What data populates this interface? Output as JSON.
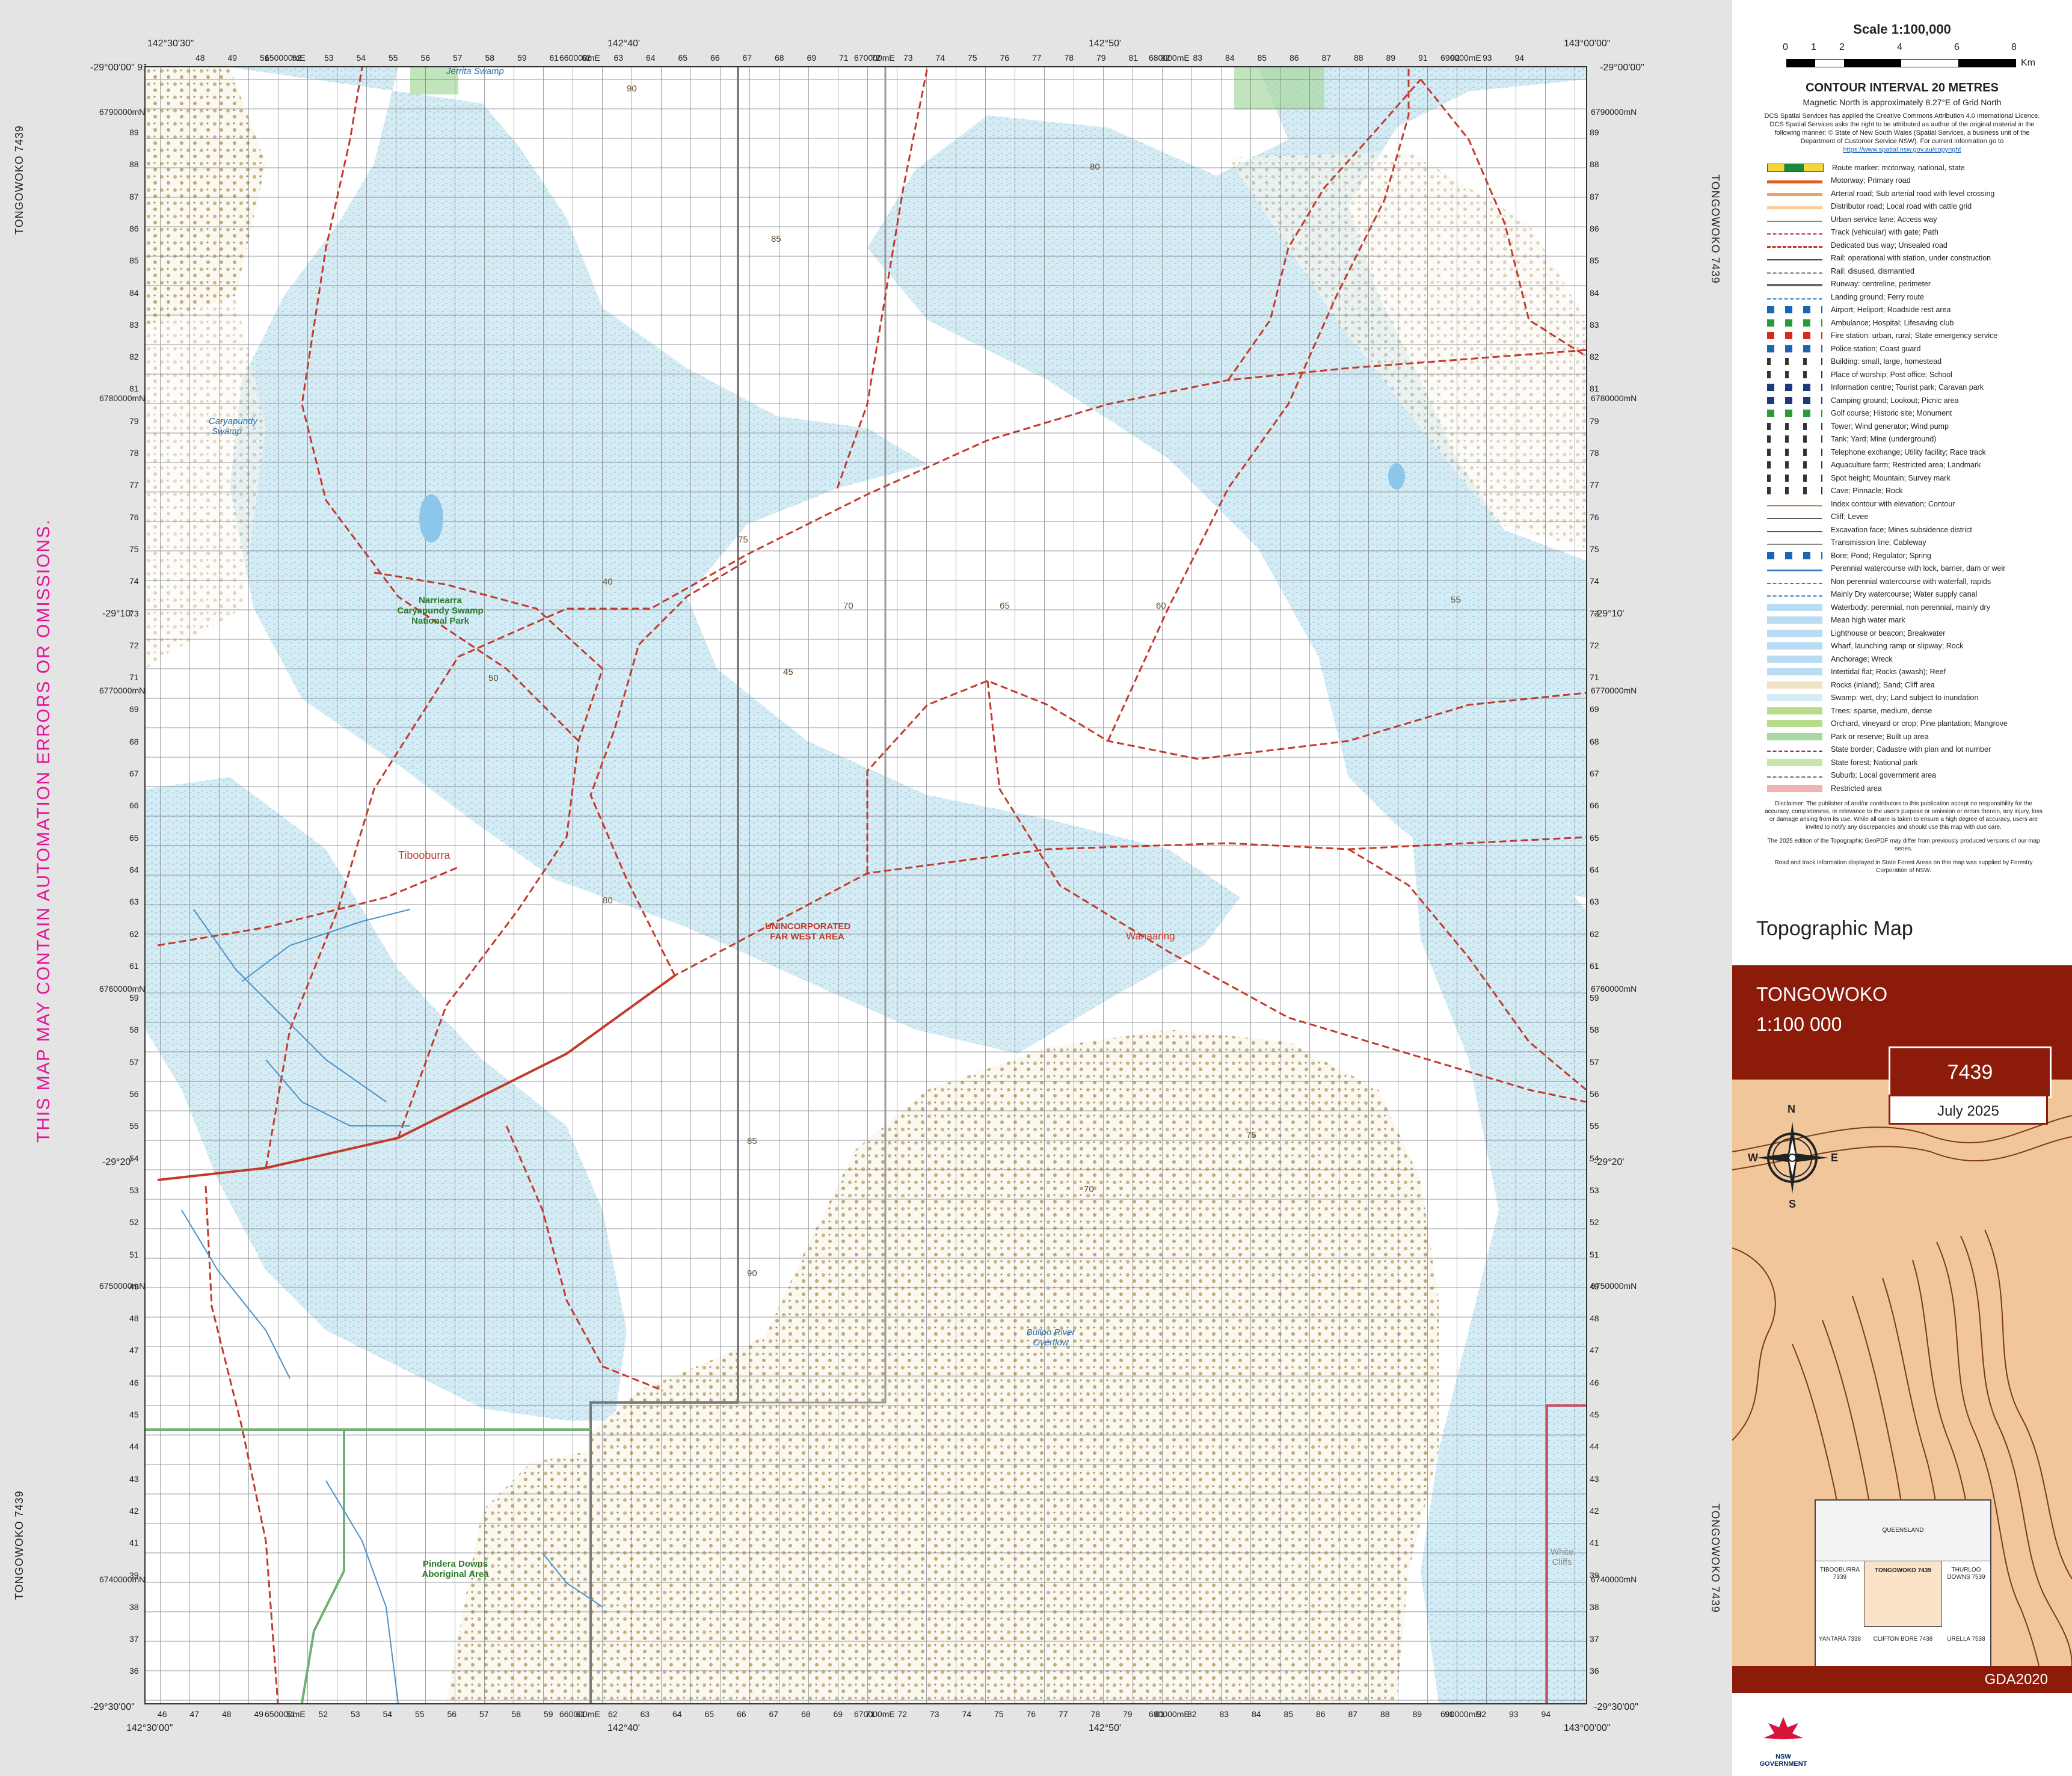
{
  "sheet": {
    "name_upper": "TONGOWOKO",
    "scale_ratio": "1:100 000",
    "sheet_number": "7439",
    "edition_date": "July 2025",
    "datum": "GDA2020",
    "edge_label": "TONGOWOKO 7439",
    "warning": "THIS MAP MAY CONTAIN AUTOMATION ERRORS OR OMISSIONS.",
    "product_title": "Topographic Map"
  },
  "coords": {
    "tl": "-29°00'00\" 91",
    "tr": "-29°00'00\"",
    "bl": "-29°30'00\"",
    "br": "-29°30'00\"",
    "lat_mid1": "-29°10'",
    "lat_mid2": "-29°20'",
    "top_lon_1": "142°30'30\"",
    "top_lon_2": "142°40'",
    "top_lon_3": "142°50'",
    "top_lon_4": "143°00'00\"",
    "bot_lon_1": "142°30'00\"",
    "bot_lon_2": "142°40'",
    "bot_lon_3": "142°50'",
    "bot_lon_4": "143°00'00\"",
    "east_a": "650000mE",
    "east_b": "660000mE",
    "east_c": "670000mE",
    "east_d": "680000mE",
    "east_e": "690000mE",
    "north_a": "6790000mN",
    "north_b": "6780000mN",
    "north_c": "6770000mN",
    "north_d": "6760000mN",
    "north_e": "6750000mN",
    "north_f": "6740000mN"
  },
  "grid": {
    "top_eastings": [
      "48",
      "49",
      "51",
      "52",
      "53",
      "54",
      "55",
      "56",
      "57",
      "58",
      "59",
      "61",
      "62",
      "63",
      "64",
      "65",
      "66",
      "67",
      "68",
      "69",
      "71",
      "72",
      "73",
      "74",
      "75",
      "76",
      "77",
      "78",
      "79",
      "81",
      "82",
      "83",
      "84",
      "85",
      "86",
      "87",
      "88",
      "89",
      "91",
      "92",
      "93",
      "94"
    ],
    "bottom_eastings": [
      "46",
      "47",
      "48",
      "49",
      "51",
      "52",
      "53",
      "54",
      "55",
      "56",
      "57",
      "58",
      "59",
      "61",
      "62",
      "63",
      "64",
      "65",
      "66",
      "67",
      "68",
      "69",
      "71",
      "72",
      "73",
      "74",
      "75",
      "76",
      "77",
      "78",
      "79",
      "81",
      "82",
      "83",
      "84",
      "85",
      "86",
      "87",
      "88",
      "89",
      "91",
      "92",
      "93",
      "94"
    ],
    "northings": [
      "89",
      "88",
      "87",
      "86",
      "85",
      "84",
      "83",
      "82",
      "81",
      "79",
      "78",
      "77",
      "76",
      "75",
      "74",
      "73",
      "72",
      "71",
      "69",
      "68",
      "67",
      "66",
      "65",
      "64",
      "63",
      "62",
      "61",
      "59",
      "58",
      "57",
      "56",
      "55",
      "54",
      "53",
      "52",
      "51",
      "49",
      "48",
      "47",
      "46",
      "45",
      "44",
      "43",
      "42",
      "41",
      "39",
      "38",
      "37",
      "36"
    ]
  },
  "places": {
    "jerrita": "Jerrita Swamp",
    "caryapundy": "Caryapundy Swamp",
    "park": "Narriearra Caryapundy Swamp National Park",
    "tibooburra": "Tibooburra",
    "unincorporated": "UNINCORPORATED FAR WEST AREA",
    "wanaaring": "Wanaaring",
    "pindera": "Pindera Downs Aboriginal Area",
    "bulloo": "Bulloo River Overflow",
    "white_cliffs": "White Cliffs"
  },
  "contour_values": [
    "90",
    "85",
    "80",
    "75",
    "70",
    "65",
    "60",
    "55",
    "50",
    "45",
    "40"
  ],
  "scale": {
    "title": "Scale 1:100,000",
    "ticks": [
      "0",
      "1",
      "2",
      "4",
      "6",
      "8"
    ],
    "unit": "Km",
    "contour_interval": "CONTOUR INTERVAL 20 METRES",
    "magnetic": "Magnetic North is approximately 8.27°E of Grid North"
  },
  "licence": {
    "text": "DCS Spatial Services has applied the Creative Commons Attribution 4.0 International Licence. DCS Spatial Services asks the right to be attributed as author of the original material in the following manner: © State of New South Wales (Spatial Services, a business unit of the Department of Customer Service NSW).",
    "more": "For current information go to",
    "link": "https://www.spatial.nsw.gov.au/copyright"
  },
  "legend": [
    {
      "label": "Route marker: motorway, national, state",
      "sym": "route"
    },
    {
      "label": "Motorway; Primary road",
      "sym": "motorway"
    },
    {
      "label": "Arterial road; Sub arterial road with level crossing",
      "sym": "arterial"
    },
    {
      "label": "Distributor road; Local road with cattle grid",
      "sym": "distributor"
    },
    {
      "label": "Urban service lane; Access way",
      "sym": "thin"
    },
    {
      "label": "Track (vehicular) with gate; Path",
      "sym": "dash"
    },
    {
      "label": "Dedicated bus way; Unsealed road",
      "sym": "unsealed"
    },
    {
      "label": "Rail: operational with station, under construction",
      "sym": "rail"
    },
    {
      "label": "Rail: disused, dismantled",
      "sym": "rail2"
    },
    {
      "label": "Runway: centreline, perimeter",
      "sym": "runway"
    },
    {
      "label": "Landing ground; Ferry route",
      "sym": "ferry"
    },
    {
      "label": "Airport; Heliport; Roadside rest area",
      "sym": "icons-blue"
    },
    {
      "label": "Ambulance; Hospital; Lifesaving club",
      "sym": "icons-green"
    },
    {
      "label": "Fire station: urban, rural; State emergency service",
      "sym": "icons-red"
    },
    {
      "label": "Police station; Coast guard",
      "sym": "icons-blue"
    },
    {
      "label": "Building: small, large, homestead",
      "sym": "icons-dark"
    },
    {
      "label": "Place of worship; Post office; School",
      "sym": "icons-dark"
    },
    {
      "label": "Information centre; Tourist park; Caravan park",
      "sym": "icons-navy"
    },
    {
      "label": "Camping ground; Lookout; Picnic area",
      "sym": "icons-navy"
    },
    {
      "label": "Golf course; Historic site; Monument",
      "sym": "icons-green"
    },
    {
      "label": "Tower; Wind generator; Wind pump",
      "sym": "icons-dark"
    },
    {
      "label": "Tank; Yard; Mine (underground)",
      "sym": "icons-dark"
    },
    {
      "label": "Telephone exchange; Utility facility; Race track",
      "sym": "icons-dark"
    },
    {
      "label": "Aquaculture farm; Restricted area; Landmark",
      "sym": "icons-dark"
    },
    {
      "label": "Spot height; Mountain; Survey mark",
      "sym": "icons-dark"
    },
    {
      "label": "Cave; Pinnacle; Rock",
      "sym": "icons-dark"
    },
    {
      "label": "Index contour with elevation; Contour",
      "sym": "contour"
    },
    {
      "label": "Cliff; Levee",
      "sym": "cliff"
    },
    {
      "label": "Excavation face; Mines subsidence district",
      "sym": "cliff"
    },
    {
      "label": "Transmission line; Cableway",
      "sym": "thin"
    },
    {
      "label": "Bore; Pond; Regulator; Spring",
      "sym": "icons-blue"
    },
    {
      "label": "Perennial watercourse with lock, barrier, dam or weir",
      "sym": "water"
    },
    {
      "label": "Non perennial watercourse with waterfall, rapids",
      "sym": "water2"
    },
    {
      "label": "Mainly Dry watercourse; Water supply canal",
      "sym": "water2"
    },
    {
      "label": "Waterbody: perennial, non perennial, mainly dry",
      "sym": "waterbody"
    },
    {
      "label": "Mean high water mark",
      "sym": "waterbody"
    },
    {
      "label": "Lighthouse or beacon; Breakwater",
      "sym": "waterbody"
    },
    {
      "label": "Wharf, launching ramp or slipway; Rock",
      "sym": "waterbody"
    },
    {
      "label": "Anchorage; Wreck",
      "sym": "waterbody"
    },
    {
      "label": "Intertidal flat; Rocks (awash); Reef",
      "sym": "waterbody"
    },
    {
      "label": "Rocks (inland); Sand; Cliff area",
      "sym": "sand"
    },
    {
      "label": "Swamp: wet, dry; Land subject to inundation",
      "sym": "swamp"
    },
    {
      "label": "Trees: sparse, medium, dense",
      "sym": "trees"
    },
    {
      "label": "Orchard, vineyard or crop; Pine plantation; Mangrove",
      "sym": "trees"
    },
    {
      "label": "Park or reserve; Built up area",
      "sym": "park"
    },
    {
      "label": "State border; Cadastre with plan and lot number",
      "sym": "border"
    },
    {
      "label": "State forest; National park",
      "sym": "forest"
    },
    {
      "label": "Suburb; Local government area",
      "sym": "border2"
    },
    {
      "label": "Restricted area",
      "sym": "restricted"
    }
  ],
  "disclaimer": {
    "text1": "Disclaimer: The publisher of and/or contributors to this publication accept no responsibility for the accuracy, completeness, or relevance to the user's purpose or omission or errors therein, any injury, loss or damage arising from its use. While all care is taken to ensure a high degree of accuracy, users are invited to notify any discrepancies and should use this map with due care.",
    "text2": "The 2025 edition of the Topographic GeoPDF may differ from previously produced versions of our map series.",
    "text3": "Road and track information displayed in State Forest Areas on this map was supplied by Forestry Corporation of NSW."
  },
  "compass": {
    "n": "N",
    "s": "S",
    "e": "E",
    "w": "W"
  },
  "index_map": {
    "top": "QUEENSLAND",
    "left": "TIBOOBURRA 7339",
    "center": "TONGOWOKO 7439",
    "right": "THURLOO DOWNS 7539",
    "bl": "YANTARA 7338",
    "bc": "CLIFTON BORE 7438",
    "br": "URELLA 7538"
  },
  "nsw_logo_text": "NSW GOVERNMENT",
  "colors": {
    "water": "#d6ecf5",
    "road": "#c23a2a",
    "banner": "#8c1b0a",
    "cover": "#f0c69a",
    "warning": "#e5139a",
    "park": "#a8d8a0"
  }
}
